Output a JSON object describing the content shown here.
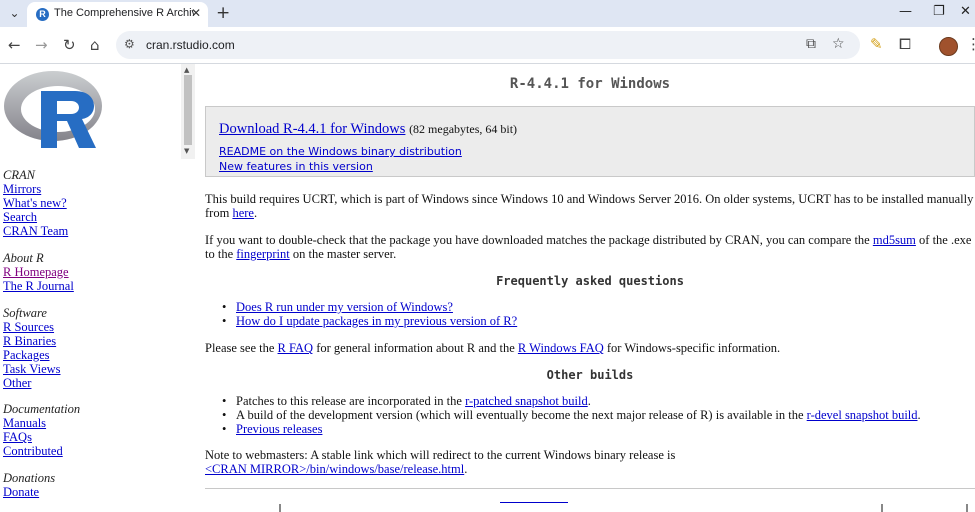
{
  "browser": {
    "tab_title": "The Comprehensive R Archive Network",
    "new_tab_label": "+",
    "url": "cran.rstudio.com"
  },
  "sidebar": {
    "cran_heading": "CRAN",
    "cran_links": [
      "Mirrors",
      "What's new?",
      "Search",
      "CRAN Team"
    ],
    "about_heading": "About R",
    "about_links": [
      "R Homepage",
      "The R Journal"
    ],
    "software_heading": "Software",
    "software_links": [
      "R Sources",
      "R Binaries",
      "Packages",
      "Task Views",
      "Other"
    ],
    "doc_heading": "Documentation",
    "doc_links": [
      "Manuals",
      "FAQs",
      "Contributed"
    ],
    "donations_heading": "Donations",
    "donations_links": [
      "Donate"
    ]
  },
  "main": {
    "title": "R-4.4.1 for Windows",
    "download_link": "Download R-4.4.1 for Windows",
    "download_size": "(82 megabytes, 64 bit)",
    "readme_link": "README on the Windows binary distribution",
    "new_features_link": "New features in this version",
    "ucrt_text_1": "This build requires UCRT, which is part of Windows since Windows 10 and Windows Server 2016. On older systems, UCRT has to be installed manually",
    "ucrt_text_2": "from",
    "ucrt_link": "here",
    "ucrt_text_3": ".",
    "check_text_1": "If you want to double-check that the package you have downloaded matches the package distributed by CRAN, you can compare the",
    "md5_link": "md5sum",
    "check_text_2": "of the .exe",
    "check_text_3": "to the",
    "fingerprint_link": "fingerprint",
    "check_text_4": "on the master server.",
    "faq_heading": "Frequently asked questions",
    "faq_items": [
      "Does R run under my version of Windows?",
      "How do I update packages in my previous version of R?"
    ],
    "see_text_1": "Please see the",
    "rfaq_link": "R FAQ",
    "see_text_2": "for general information about R and the",
    "rwinfaq_link": "R Windows FAQ",
    "see_text_3": "for Windows-specific information.",
    "other_heading": "Other builds",
    "other_1_text": "Patches to this release are incorporated in the",
    "other_1_link": "r-patched snapshot build",
    "other_1_end": ".",
    "other_2_text": "A build of the development version (which will eventually become the next major release of R) is available in the",
    "other_2_link": "r-devel snapshot build",
    "other_2_end": ".",
    "other_3_link": "Previous releases",
    "note_text": "Note to webmasters: A stable link which will redirect to the current Windows binary release is",
    "note_link": "<CRAN MIRROR>/bin/windows/base/release.html",
    "note_end": "."
  }
}
